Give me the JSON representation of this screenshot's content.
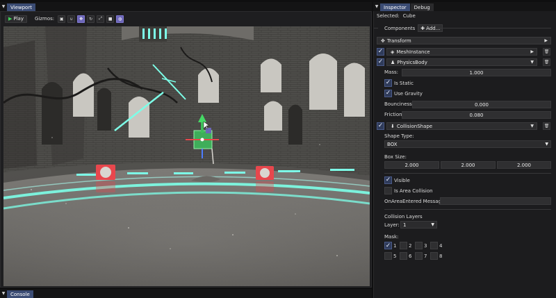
{
  "viewport": {
    "tab_label": "Viewport",
    "toolbar": {
      "play_label": "Play",
      "gizmos_label": "Gizmos:",
      "gizmo_buttons": [
        "box-icon",
        "magnet-icon",
        "move-icon",
        "rotate-icon",
        "scale-icon",
        "camera-icon",
        "globe-icon"
      ]
    }
  },
  "console": {
    "tab_label": "Console"
  },
  "inspector": {
    "tabs": [
      "Inspector",
      "Debug"
    ],
    "selected_label": "Selected:",
    "selected_value": "Cube",
    "components_label": "Components",
    "add_button_label": "Add...",
    "transform": {
      "label": "Transform"
    },
    "mesh_instance": {
      "label": "MeshInstance",
      "enabled": true
    },
    "physics_body": {
      "label": "PhysicsBody",
      "enabled": true,
      "mass_label": "Mass:",
      "mass_value": "1.000",
      "is_static_label": "Is Static",
      "is_static": true,
      "use_gravity_label": "Use Gravity",
      "use_gravity": true,
      "bounciness_label": "Bounciness:",
      "bounciness_value": "0.000",
      "friction_label": "Friction:",
      "friction_value": "0.080"
    },
    "collision_shape": {
      "label": "CollisionShape",
      "enabled": true,
      "shape_type_label": "Shape Type:",
      "shape_type_value": "BOX",
      "box_size_label": "Box Size:",
      "box_size": [
        "2.000",
        "2.000",
        "2.000"
      ],
      "visible_label": "Visible",
      "visible": true,
      "is_area_label": "Is Area Collision",
      "is_area": false,
      "on_area_label": "OnAreaEntered Message:",
      "on_area_value": ""
    },
    "collision_layers": {
      "title": "Collision Layers",
      "layer_label": "Layer:",
      "layer_value": "1",
      "mask_label": "Mask:",
      "mask": [
        {
          "n": "1",
          "checked": true
        },
        {
          "n": "2",
          "checked": false
        },
        {
          "n": "3",
          "checked": false
        },
        {
          "n": "4",
          "checked": false
        },
        {
          "n": "5",
          "checked": false
        },
        {
          "n": "6",
          "checked": false
        },
        {
          "n": "7",
          "checked": false
        },
        {
          "n": "8",
          "checked": false
        }
      ]
    }
  },
  "colors": {
    "accent": "#3b4c74",
    "play_green": "#42d35a",
    "neon_cyan": "#7dffe8",
    "target_red": "#e8474d"
  }
}
